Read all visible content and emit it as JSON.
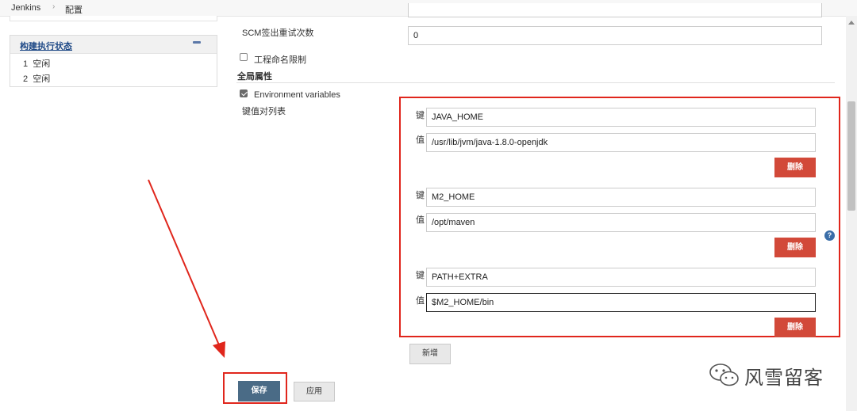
{
  "breadcrumb": {
    "root": "Jenkins",
    "separator": "›",
    "current": "配置"
  },
  "sidebar": {
    "executor_panel": {
      "title": "构建执行状态",
      "rows": [
        {
          "num": "1",
          "state": "空闲"
        },
        {
          "num": "2",
          "state": "空闲"
        }
      ]
    }
  },
  "form": {
    "scm_retry_label": "SCM签出重试次数",
    "scm_retry_value": "0",
    "project_naming_label": "工程命名限制",
    "global_props_heading": "全局属性",
    "env_vars_label": "Environment variables",
    "kv_list_label": "键值对列表",
    "key_label": "键",
    "value_label": "值",
    "delete_label": "删除",
    "entries": [
      {
        "key": "JAVA_HOME",
        "value": "/usr/lib/jvm/java-1.8.0-openjdk"
      },
      {
        "key": "M2_HOME",
        "value": "/opt/maven"
      },
      {
        "key": "PATH+EXTRA",
        "value": "$M2_HOME/bin"
      }
    ],
    "add_label": "新增",
    "help_glyph": "?"
  },
  "actions": {
    "save_label": "保存",
    "apply_label": "应用"
  },
  "watermark": {
    "text": "风雪留客"
  },
  "colors": {
    "highlight": "#e0261c",
    "delete_button": "#d24939",
    "save_button": "#4a6b86",
    "link": "#204a87"
  }
}
